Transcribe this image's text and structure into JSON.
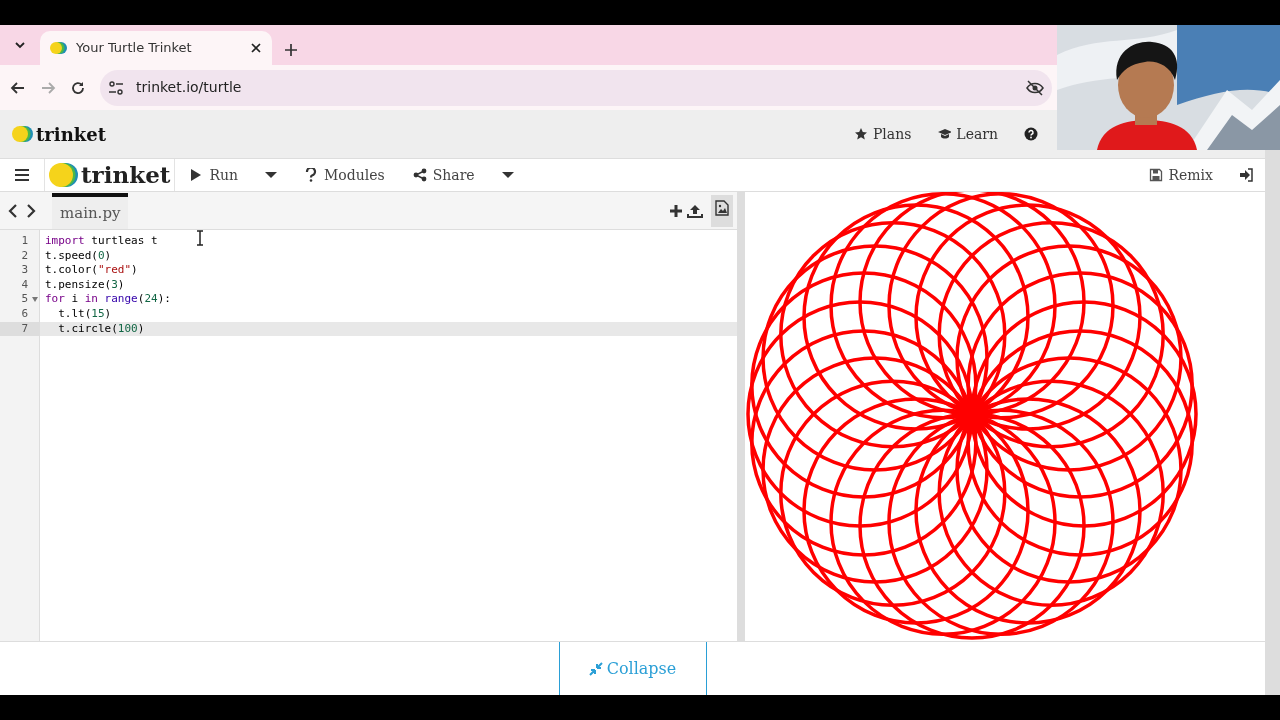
{
  "browser": {
    "tab_title": "Your Turtle Trinket",
    "url": "trinket.io/turtle"
  },
  "site_header": {
    "brand": "trinket",
    "links": [
      "Plans",
      "Learn"
    ]
  },
  "toolbar": {
    "brand": "trinket",
    "left": [
      "Run",
      "Modules",
      "Share"
    ],
    "right": [
      "Remix"
    ]
  },
  "editor": {
    "files": [
      {
        "label": "main.py",
        "selected": true
      }
    ],
    "lines": [
      {
        "number": "1",
        "active": false,
        "foldable": false,
        "tokens": [
          {
            "text": "import",
            "kind": "keyword"
          },
          {
            "text": " turtleas t",
            "kind": "plain"
          }
        ]
      },
      {
        "number": "2",
        "active": false,
        "foldable": false,
        "tokens": [
          {
            "text": "t.speed(",
            "kind": "plain"
          },
          {
            "text": "0",
            "kind": "number"
          },
          {
            "text": ")",
            "kind": "plain"
          }
        ]
      },
      {
        "number": "3",
        "active": false,
        "foldable": false,
        "tokens": [
          {
            "text": "t.color(",
            "kind": "plain"
          },
          {
            "text": "\"red\"",
            "kind": "string"
          },
          {
            "text": ")",
            "kind": "plain"
          }
        ]
      },
      {
        "number": "4",
        "active": false,
        "foldable": false,
        "tokens": [
          {
            "text": "t.pensize(",
            "kind": "plain"
          },
          {
            "text": "3",
            "kind": "number"
          },
          {
            "text": ")",
            "kind": "plain"
          }
        ]
      },
      {
        "number": "5",
        "active": false,
        "foldable": true,
        "tokens": [
          {
            "text": "for",
            "kind": "keyword"
          },
          {
            "text": " i ",
            "kind": "plain"
          },
          {
            "text": "in",
            "kind": "keyword"
          },
          {
            "text": " range",
            "kind": "builtin"
          },
          {
            "text": "(",
            "kind": "plain"
          },
          {
            "text": "24",
            "kind": "number"
          },
          {
            "text": "):",
            "kind": "plain"
          }
        ]
      },
      {
        "number": "6",
        "active": false,
        "foldable": false,
        "tokens": [
          {
            "text": "  t.lt(",
            "kind": "plain"
          },
          {
            "text": "15",
            "kind": "number"
          },
          {
            "text": ")",
            "kind": "plain"
          }
        ]
      },
      {
        "number": "7",
        "active": true,
        "foldable": false,
        "tokens": [
          {
            "text": "  t.circle(",
            "kind": "plain"
          },
          {
            "text": "100",
            "kind": "number"
          },
          {
            "text": ")",
            "kind": "plain"
          }
        ]
      }
    ]
  },
  "footer": {
    "button": "Collapse"
  }
}
